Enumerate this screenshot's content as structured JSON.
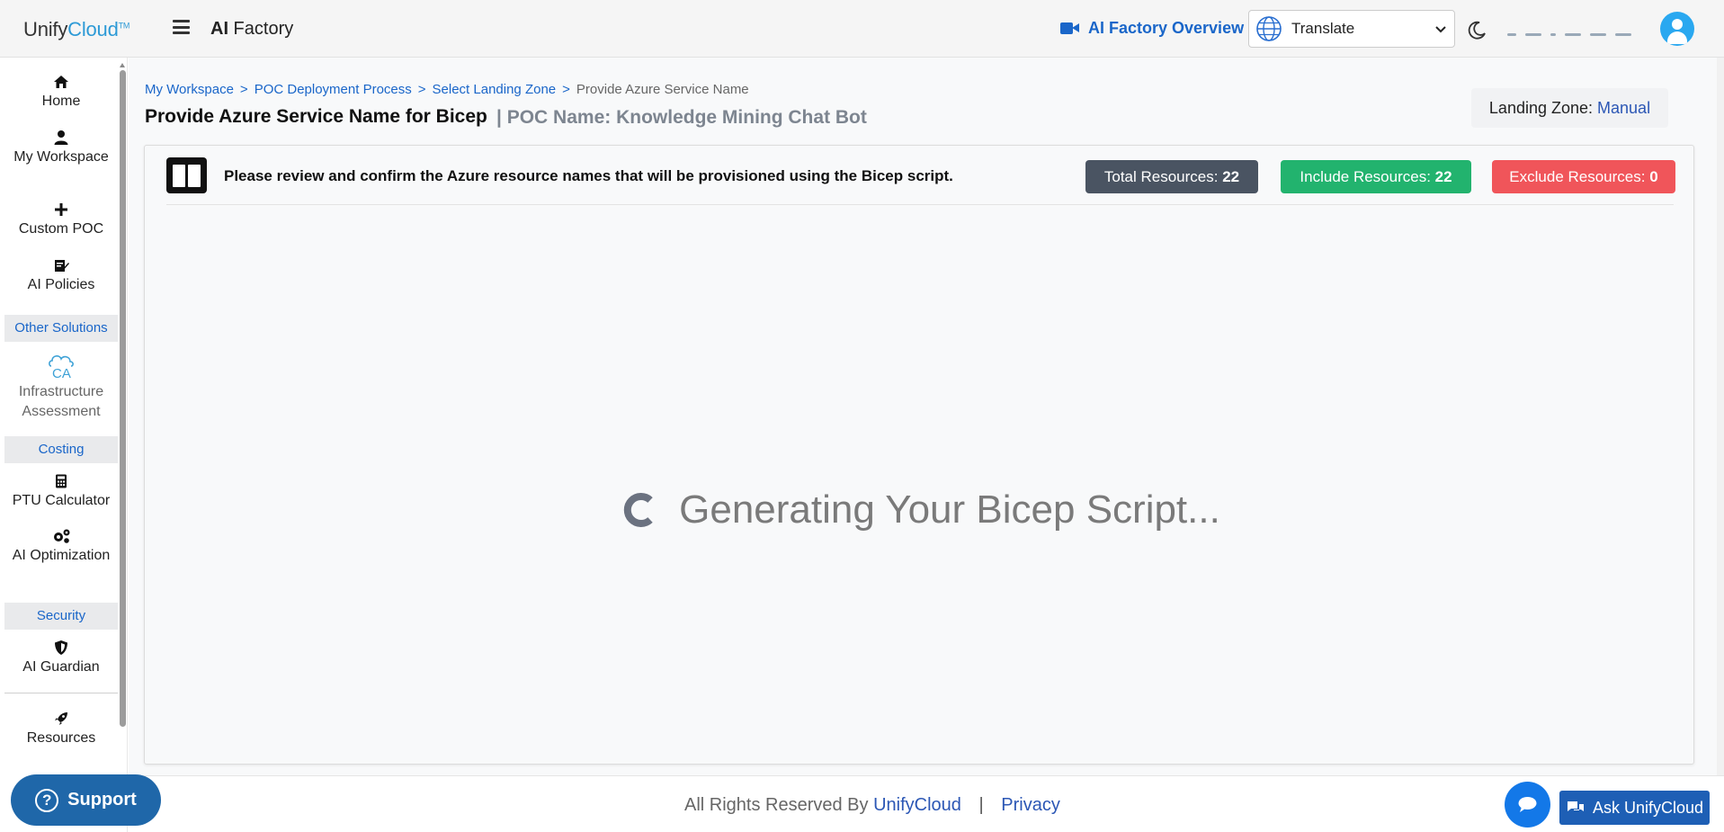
{
  "header": {
    "logo_prefix": "Unify",
    "logo_brand": "Cloud",
    "logo_tm": "TM",
    "app_title_bold": "AI",
    "app_title_rest": " Factory",
    "overview_label": "AI Factory Overview",
    "translate_label": "Translate"
  },
  "sidebar": {
    "items": [
      {
        "label": "Home",
        "icon": "home-icon"
      },
      {
        "label": "My Workspace",
        "icon": "user-icon"
      },
      {
        "label": "Custom POC",
        "icon": "plus-icon"
      },
      {
        "label": "AI Policies",
        "icon": "policy-icon"
      },
      {
        "label": "Infrastructure Assessment",
        "icon": "cloud-ca-icon"
      },
      {
        "label": "PTU Calculator",
        "icon": "calculator-icon"
      },
      {
        "label": "AI Optimization",
        "icon": "gears-icon"
      },
      {
        "label": "AI Guardian",
        "icon": "shield-icon"
      },
      {
        "label": "Resources",
        "icon": "rocket-icon"
      }
    ],
    "sections": {
      "other": "Other Solutions",
      "costing": "Costing",
      "security": "Security"
    }
  },
  "breadcrumb": {
    "items": [
      "My Workspace",
      "POC Deployment Process",
      "Select Landing Zone"
    ],
    "separator": ">",
    "current": "Provide Azure Service Name"
  },
  "page": {
    "title": "Provide Azure Service Name for Bicep",
    "poc_name": "| POC Name: Knowledge Mining Chat Bot",
    "landing_zone_label": "Landing Zone:",
    "landing_zone_value": "Manual"
  },
  "panel": {
    "info_text": "Please review and confirm the Azure resource names that will be provisioned using the Bicep script.",
    "total_label": "Total Resources:",
    "total_value": "22",
    "include_label": "Include Resources:",
    "include_value": "22",
    "exclude_label": "Exclude Resources:",
    "exclude_value": "0",
    "loading_text": "Generating Your Bicep Script..."
  },
  "footer": {
    "rights": "All Rights Reserved By",
    "brand": "UnifyCloud",
    "separator": "|",
    "privacy": "Privacy"
  },
  "support_label": "Support",
  "ask_label": "Ask UnifyCloud",
  "colors": {
    "accent": "#1a66c9",
    "total": "#4a5462",
    "include": "#22b36e",
    "exclude": "#f0555a",
    "support": "#1f67a9"
  }
}
